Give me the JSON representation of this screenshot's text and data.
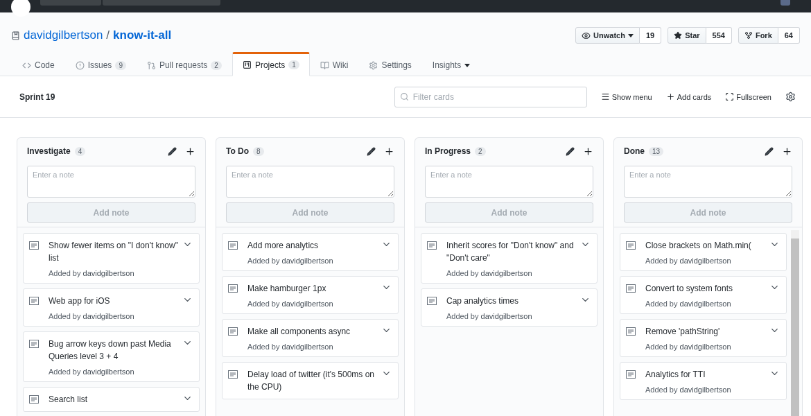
{
  "repo": {
    "owner": "davidgilbertson",
    "separator": "/",
    "name": "know-it-all",
    "actions": [
      {
        "kind": "watch",
        "label": "Unwatch",
        "count": "19",
        "dropdown": true
      },
      {
        "kind": "star",
        "label": "Star",
        "count": "554",
        "dropdown": false
      },
      {
        "kind": "fork",
        "label": "Fork",
        "count": "64",
        "dropdown": false
      }
    ]
  },
  "tabs": [
    {
      "kind": "code",
      "label": "Code",
      "selected": false
    },
    {
      "kind": "issues",
      "label": "Issues",
      "counter": "9",
      "selected": false
    },
    {
      "kind": "pulls",
      "label": "Pull requests",
      "counter": "2",
      "selected": false
    },
    {
      "kind": "projects",
      "label": "Projects",
      "counter": "1",
      "selected": true
    },
    {
      "kind": "wiki",
      "label": "Wiki",
      "selected": false
    },
    {
      "kind": "settings",
      "label": "Settings",
      "selected": false
    },
    {
      "kind": "insights",
      "label": "Insights",
      "selected": false,
      "dropdown": true
    }
  ],
  "project": {
    "title": "Sprint 19",
    "filter_placeholder": "Filter cards",
    "tools": [
      {
        "kind": "menu",
        "label": "Show menu"
      },
      {
        "kind": "add",
        "label": "Add cards"
      },
      {
        "kind": "fullscreen",
        "label": "Fullscreen"
      }
    ]
  },
  "columns": [
    {
      "name": "Investigate",
      "count": "4",
      "note_placeholder": "Enter a note",
      "add_button": {
        "label": "Add note",
        "disabled": true
      },
      "scrollbar": false,
      "cards": [
        {
          "title": "Show fewer items on \"I don't know\" list",
          "added_by": "Added by **davidgilbertson**"
        },
        {
          "title": "Web app for iOS",
          "added_by": "Added by **davidgilbertson**"
        },
        {
          "title": "Bug arrow keys down past Media Queries level 3 + 4",
          "added_by": "Added by **davidgilbertson**"
        },
        {
          "title": "Search list"
        }
      ]
    },
    {
      "name": "To Do",
      "count": "8",
      "note_placeholder": "Enter a note",
      "add_button": {
        "label": "Add note",
        "disabled": true
      },
      "scrollbar": false,
      "cards": [
        {
          "title": "Add more analytics",
          "added_by": "Added by **davidgilbertson**"
        },
        {
          "title": "Make hamburger 1px",
          "added_by": "Added by **davidgilbertson**"
        },
        {
          "title": "Make all components async",
          "added_by": "Added by **davidgilbertson**"
        },
        {
          "title": "Delay load of twitter (it's 500ms on the CPU)"
        }
      ]
    },
    {
      "name": "In Progress",
      "count": "2",
      "note_placeholder": "Enter a note",
      "add_button": {
        "label": "Add note",
        "disabled": true
      },
      "scrollbar": false,
      "cards": [
        {
          "title": "Inherit scores for \"Don't know\" and \"Don't care\"",
          "added_by": "Added by **davidgilbertson**"
        },
        {
          "title": "Cap analytics times",
          "added_by": "Added by **davidgilbertson**"
        }
      ]
    },
    {
      "name": "Done",
      "count": "13",
      "note_placeholder": "Enter a note",
      "add_button": {
        "label": "Add note",
        "disabled": true
      },
      "scrollbar": true,
      "cards": [
        {
          "title": "Close brackets on Math.min(",
          "added_by": "Added by **davidgilbertson**"
        },
        {
          "title": "Convert to system fonts",
          "added_by": "Added by **davidgilbertson**"
        },
        {
          "title": "Remove 'pathString'",
          "added_by": "Added by **davidgilbertson**"
        },
        {
          "title": "Analytics for TTI",
          "added_by": "Added by **davidgilbertson**"
        }
      ]
    }
  ]
}
